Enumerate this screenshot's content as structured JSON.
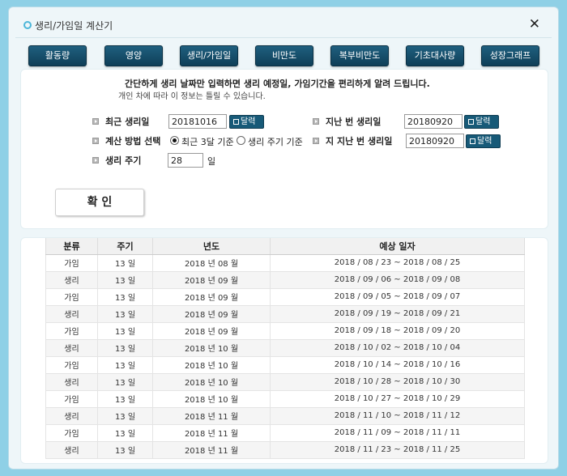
{
  "window": {
    "title": "생리/가임일 계산기",
    "close": "✕"
  },
  "tabs": [
    "활동량",
    "영양",
    "생리/가임일",
    "비만도",
    "복부비만도",
    "기초대사량",
    "성장그래프"
  ],
  "intro": {
    "line1": "간단하게 생리 날짜만 입력하면 생리 예정일, 가임기간을 편리하게 알려 드립니다.",
    "line2": "개인 차에 따라 이 정보는 틀릴 수 있습니다."
  },
  "form": {
    "recent_label": "최근 생리일",
    "recent_value": "20181016",
    "last_label": "지난 번 생리일",
    "last_value": "20180920",
    "method_label": "계산 방법 선택",
    "method_opt1": "최근 3달 기준",
    "method_opt2": "생리 주기 기준",
    "before_last_label": "지 지난 번 생리일",
    "before_last_value": "20180920",
    "cycle_label": "생리 주기",
    "cycle_value": "28",
    "cycle_unit": "일",
    "calendar_label": "달력",
    "confirm_label": "확 인"
  },
  "table": {
    "headers": [
      "분류",
      "주기",
      "년도",
      "예상 일자"
    ],
    "rows": [
      [
        "가임",
        "13 일",
        "2018 년 08 월",
        "2018 / 08 / 23 ~ 2018 / 08 / 25"
      ],
      [
        "생리",
        "13 일",
        "2018 년 09 월",
        "2018 / 09 / 06 ~ 2018 / 09 / 08"
      ],
      [
        "가임",
        "13 일",
        "2018 년 09 월",
        "2018 / 09 / 05 ~ 2018 / 09 / 07"
      ],
      [
        "생리",
        "13 일",
        "2018 년 09 월",
        "2018 / 09 / 19 ~ 2018 / 09 / 21"
      ],
      [
        "가임",
        "13 일",
        "2018 년 09 월",
        "2018 / 09 / 18 ~ 2018 / 09 / 20"
      ],
      [
        "생리",
        "13 일",
        "2018 년 10 월",
        "2018 / 10 / 02 ~ 2018 / 10 / 04"
      ],
      [
        "가임",
        "13 일",
        "2018 년 10 월",
        "2018 / 10 / 14 ~ 2018 / 10 / 16"
      ],
      [
        "생리",
        "13 일",
        "2018 년 10 월",
        "2018 / 10 / 28 ~ 2018 / 10 / 30"
      ],
      [
        "가임",
        "13 일",
        "2018 년 10 월",
        "2018 / 10 / 27 ~ 2018 / 10 / 29"
      ],
      [
        "생리",
        "13 일",
        "2018 년 11 월",
        "2018 / 11 / 10 ~ 2018 / 11 / 12"
      ],
      [
        "가임",
        "13 일",
        "2018 년 11 월",
        "2018 / 11 / 09 ~ 2018 / 11 / 11"
      ],
      [
        "생리",
        "13 일",
        "2018 년 11 월",
        "2018 / 11 / 23 ~ 2018 / 11 / 25"
      ]
    ]
  }
}
